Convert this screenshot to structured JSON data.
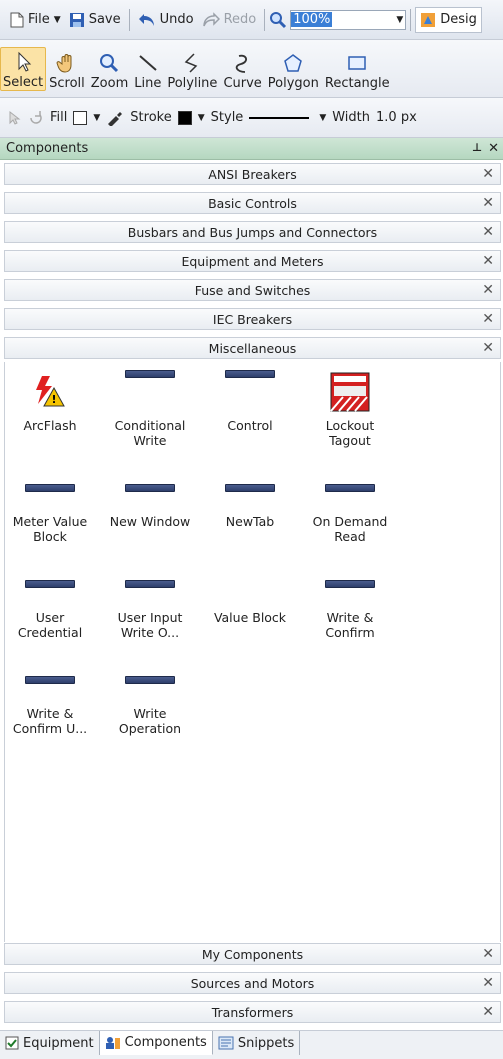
{
  "toolbar": {
    "file_label": "File",
    "save_label": "Save",
    "undo_label": "Undo",
    "redo_label": "Redo",
    "zoom_value": "100%",
    "design_label": "Desig"
  },
  "tools": [
    {
      "label": "Select"
    },
    {
      "label": "Scroll"
    },
    {
      "label": "Zoom"
    },
    {
      "label": "Line"
    },
    {
      "label": "Polyline"
    },
    {
      "label": "Curve"
    },
    {
      "label": "Polygon"
    },
    {
      "label": "Rectangle"
    }
  ],
  "format": {
    "fill_label": "Fill",
    "stroke_label": "Stroke",
    "style_label": "Style",
    "width_label": "Width",
    "width_value": "1.0 px"
  },
  "pane": {
    "title": "Components",
    "pin_glyph": "📌",
    "close_glyph": "✕"
  },
  "categories_top": [
    {
      "label": "ANSI Breakers"
    },
    {
      "label": "Basic Controls"
    },
    {
      "label": "Busbars and Bus Jumps and Connectors"
    },
    {
      "label": "Equipment and Meters"
    },
    {
      "label": "Fuse and Switches"
    },
    {
      "label": "IEC Breakers"
    },
    {
      "label": "Miscellaneous"
    }
  ],
  "components": [
    {
      "label": "ArcFlash",
      "icon": "arcflash-icon"
    },
    {
      "label": "Conditional\nWrite",
      "icon": "button-thumb-icon"
    },
    {
      "label": "Control",
      "icon": "button-thumb-icon"
    },
    {
      "label": "Lockout\nTagout",
      "icon": "lockout-icon"
    },
    {
      "label": "Meter Value\nBlock",
      "icon": "button-thumb-icon"
    },
    {
      "label": "New Window",
      "icon": "button-thumb-icon"
    },
    {
      "label": "NewTab",
      "icon": "button-thumb-icon"
    },
    {
      "label": "On Demand\nRead",
      "icon": "button-thumb-icon"
    },
    {
      "label": "User\nCredential",
      "icon": "button-thumb-icon"
    },
    {
      "label": "User Input\nWrite O...",
      "icon": "button-thumb-icon"
    },
    {
      "label": "Value Block",
      "icon": "none"
    },
    {
      "label": "Write &\nConfirm",
      "icon": "button-thumb-icon"
    },
    {
      "label": "Write &\nConfirm U...",
      "icon": "button-thumb-icon"
    },
    {
      "label": "Write\nOperation",
      "icon": "button-thumb-icon"
    }
  ],
  "categories_bottom": [
    {
      "label": "My Components"
    },
    {
      "label": "Sources and Motors"
    },
    {
      "label": "Transformers"
    }
  ],
  "bottom_tabs": [
    {
      "label": "Equipment"
    },
    {
      "label": "Components"
    },
    {
      "label": "Snippets"
    }
  ],
  "colors": {
    "pane_header": "#b5d7c0",
    "selection": "#3b7fd6",
    "active_tool": "#fbe3a6"
  }
}
